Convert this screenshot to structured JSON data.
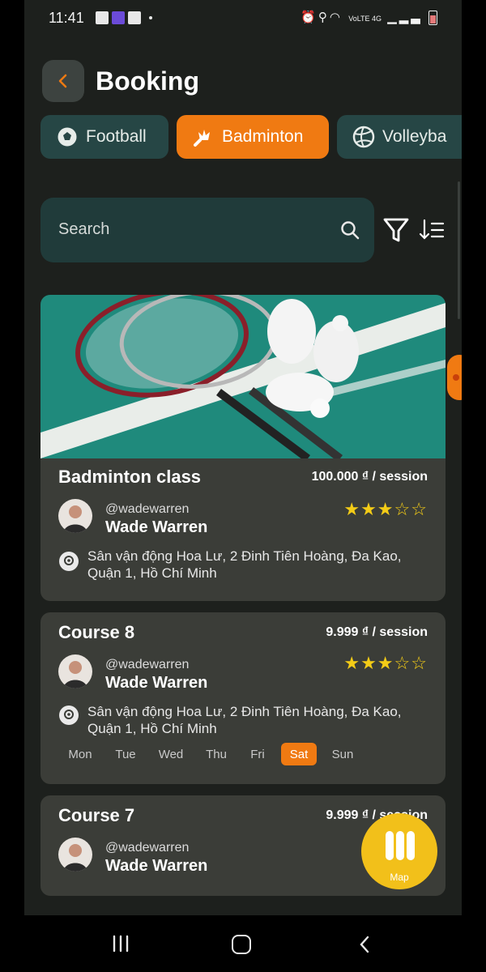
{
  "status_bar": {
    "time": "11:41",
    "right": "VoLTE 4G"
  },
  "header": {
    "title": "Booking"
  },
  "tabs": [
    {
      "label": "Football",
      "icon": "soccer-ball-icon",
      "active": false
    },
    {
      "label": "Badminton",
      "icon": "shuttlecock-icon",
      "active": true
    },
    {
      "label": "Volleyba",
      "icon": "volleyball-icon",
      "active": false
    }
  ],
  "search": {
    "placeholder": "Search"
  },
  "cards": [
    {
      "title": "Badminton class",
      "price": "100.000 ₫ / session",
      "handle": "@wadewarren",
      "name": "Wade Warren",
      "rating": 3,
      "address": "Sân vận động Hoa Lư, 2 Đinh Tiên Hoàng, Đa Kao, Quận 1, Hồ Chí Minh"
    },
    {
      "title": "Course 8",
      "price": "9.999 ₫ / session",
      "handle": "@wadewarren",
      "name": "Wade Warren",
      "rating": 3,
      "address": "Sân vận động Hoa Lư, 2 Đinh Tiên Hoàng, Đa Kao, Quận 1, Hồ Chí Minh",
      "days": [
        "Mon",
        "Tue",
        "Wed",
        "Thu",
        "Fri",
        "Sat",
        "Sun"
      ],
      "selected_day": "Sat"
    },
    {
      "title": "Course 7",
      "price": "9.999 ₫ / session",
      "handle": "@wadewarren",
      "name": "Wade Warren"
    }
  ],
  "map_button": {
    "label": "Map"
  },
  "colors": {
    "accent": "#f07a12",
    "star": "#f4cc17",
    "background": "#1d201d",
    "card": "#3b3d38",
    "tab_inactive": "#264645"
  }
}
